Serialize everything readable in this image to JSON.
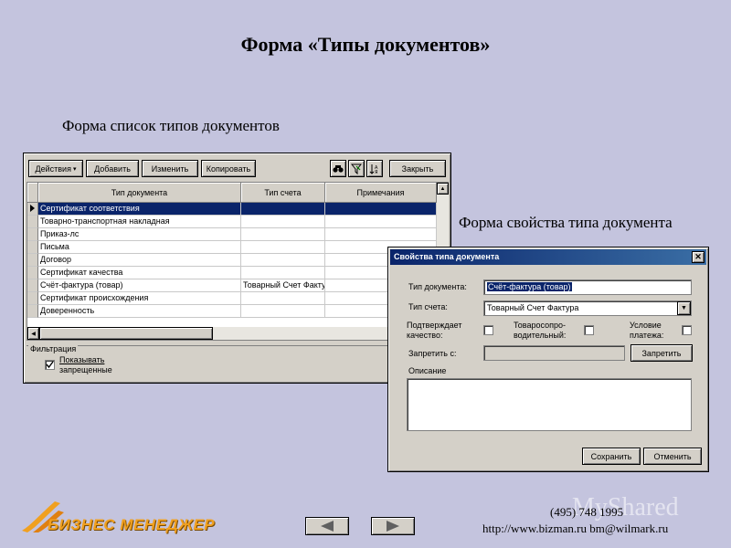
{
  "slide": {
    "title": "Форма «Типы документов»",
    "caption_list": "Форма список типов документов",
    "caption_props": "Форма свойства типа документа",
    "logo_text": "БИЗНЕС МЕНЕДЖЕР",
    "phone": "(495) 748 1995",
    "contacts": "http://www.bizman.ru  bm@wilmark.ru",
    "watermark": "MyShared"
  },
  "list_window": {
    "toolbar": {
      "actions": "Действия",
      "add": "Добавить",
      "edit": "Изменить",
      "copy": "Копировать",
      "close": "Закрыть"
    },
    "columns": [
      "Тип документа",
      "Тип счета",
      "Примечания"
    ],
    "rows": [
      {
        "type": "Сертификат соответствия",
        "account": "",
        "note": ""
      },
      {
        "type": "Товарно-транспортная накладная",
        "account": "",
        "note": ""
      },
      {
        "type": "Приказ-лс",
        "account": "",
        "note": ""
      },
      {
        "type": "Письма",
        "account": "",
        "note": ""
      },
      {
        "type": "Договор",
        "account": "",
        "note": ""
      },
      {
        "type": "Сертификат качества",
        "account": "",
        "note": ""
      },
      {
        "type": "Счёт-фактура (товар)",
        "account": "Товарный Счет Факту",
        "note": ""
      },
      {
        "type": "Сертификат происхождения",
        "account": "",
        "note": ""
      },
      {
        "type": "Доверенность",
        "account": "",
        "note": ""
      }
    ],
    "filter": {
      "group_label": "Фильтрация",
      "show_forbidden_line1": "Показывать",
      "show_forbidden_line2": "запрещенные",
      "checked": true
    }
  },
  "props_window": {
    "title": "Свойства типа документа",
    "doc_type_label": "Тип документа:",
    "doc_type_value": "Счёт-фактура (товар)",
    "account_type_label": "Тип счета:",
    "account_type_value": "Товарный Счет Фактура",
    "confirm_quality_line1": "Подтверждает",
    "confirm_quality_line2": "качество:",
    "accompanying_line1": "Товаросопро-",
    "accompanying_line2": "водительный:",
    "payment_cond_line1": "Условие",
    "payment_cond_line2": "платежа:",
    "forbid_from_label": "Запретить с:",
    "forbid_button": "Запретить",
    "description_label": "Описание",
    "save_button": "Сохранить",
    "cancel_button": "Отменить"
  }
}
